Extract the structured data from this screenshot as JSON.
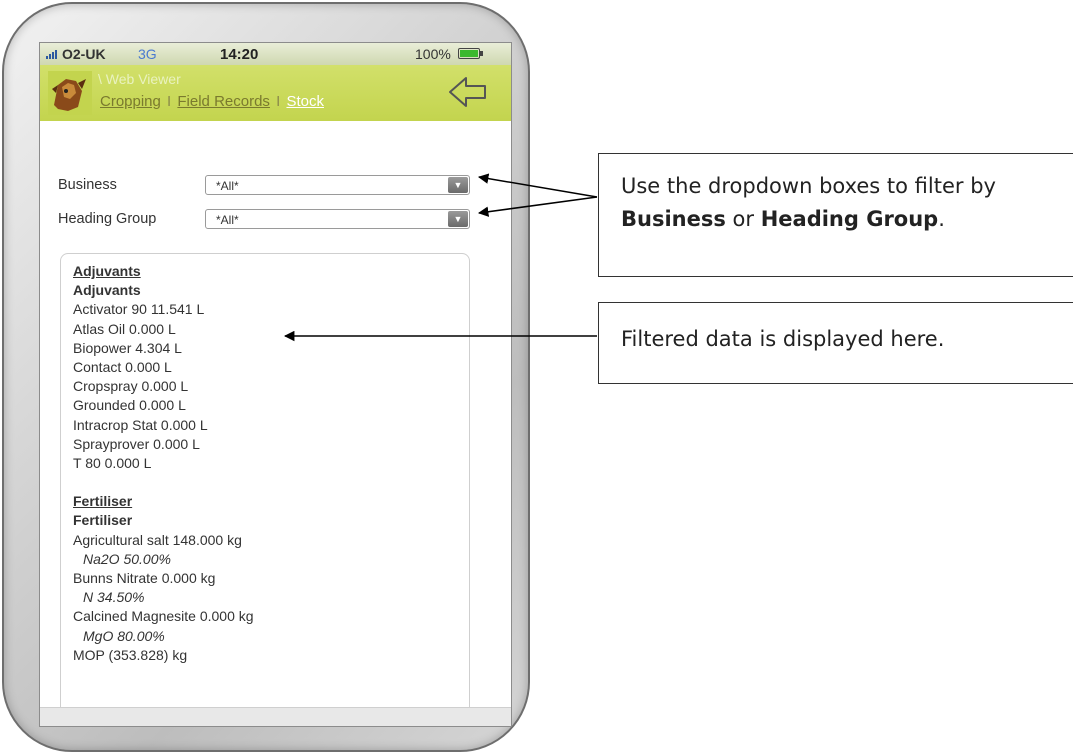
{
  "status_bar": {
    "carrier": "O2-UK",
    "network": "3G",
    "time": "14:20",
    "battery": "100%"
  },
  "header": {
    "app_title": "\\ Web Viewer",
    "nav": {
      "cropping": "Cropping",
      "field_records": "Field Records",
      "stock": "Stock",
      "separator": "I"
    }
  },
  "filters": {
    "business": {
      "label": "Business",
      "value": "*All*"
    },
    "heading_group": {
      "label": "Heading Group",
      "value": "*All*"
    }
  },
  "data_list": {
    "adjuvants": {
      "category": "Adjuvants",
      "group": "Adjuvants",
      "items": [
        "Activator 90 11.541 L",
        "Atlas Oil 0.000 L",
        "Biopower 4.304 L",
        "Contact 0.000 L",
        "Cropspray 0.000 L",
        "Grounded 0.000 L",
        "Intracrop Stat 0.000 L",
        "Sprayprover 0.000 L",
        "T 80 0.000 L"
      ]
    },
    "fertiliser": {
      "category": "Fertiliser",
      "group": "Fertiliser",
      "items": [
        {
          "name": "Agricultural salt 148.000 kg",
          "nutrient": "Na2O 50.00%"
        },
        {
          "name": "Bunns Nitrate 0.000 kg",
          "nutrient": "N 34.50%"
        },
        {
          "name": "Calcined Magnesite 0.000 kg",
          "nutrient": "MgO 80.00%"
        },
        {
          "name": "MOP (353.828) kg",
          "nutrient": ""
        }
      ]
    }
  },
  "callouts": {
    "filter": {
      "prefix": "Use the dropdown boxes to filter by ",
      "business": "Business",
      "middle": " or ",
      "heading_group": "Heading Group",
      "suffix": "."
    },
    "display": {
      "text": "Filtered data is displayed here."
    }
  },
  "colors": {
    "header_green": "#c3d44e",
    "active_link": "#ffffff",
    "link": "#7a7a2e"
  }
}
